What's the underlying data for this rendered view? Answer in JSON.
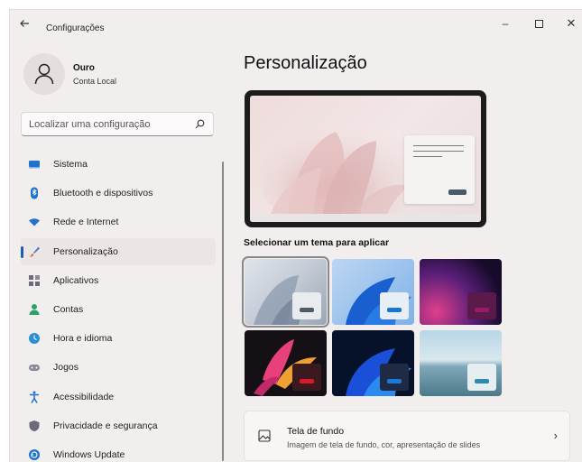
{
  "window": {
    "title": "Configurações",
    "back_icon": "arrow-left-icon",
    "controls": {
      "minimize": "–",
      "close": "✕"
    }
  },
  "profile": {
    "name": "Ouro",
    "account_type": "Conta Local",
    "avatar_icon": "person-icon"
  },
  "search": {
    "placeholder": "Localizar uma configuração",
    "icon": "search-icon"
  },
  "sidebar": {
    "items": [
      {
        "label": "Sistema",
        "icon": "monitor-icon",
        "color": "#1f73c9"
      },
      {
        "label": "Bluetooth e dispositivos",
        "icon": "bluetooth-icon",
        "color": "#1f73c9"
      },
      {
        "label": "Rede e Internet",
        "icon": "wifi-icon",
        "color": "#1f73c9"
      },
      {
        "label": "Personalização",
        "icon": "brush-icon",
        "color": "#d97a2b",
        "active": true
      },
      {
        "label": "Aplicativos",
        "icon": "apps-icon",
        "color": "#6b6b7b"
      },
      {
        "label": "Contas",
        "icon": "account-icon",
        "color": "#2aa36b"
      },
      {
        "label": "Hora e idioma",
        "icon": "globe-clock-icon",
        "color": "#2b8fd6"
      },
      {
        "label": "Jogos",
        "icon": "gamepad-icon",
        "color": "#7a7a86"
      },
      {
        "label": "Acessibilidade",
        "icon": "accessibility-icon",
        "color": "#1f6fd1"
      },
      {
        "label": "Privacidade e segurança",
        "icon": "shield-icon",
        "color": "#6b6b7b"
      },
      {
        "label": "Windows Update",
        "icon": "update-icon",
        "color": "#1f73c9"
      }
    ]
  },
  "main": {
    "title": "Personalização",
    "themes_label": "Selecionar um tema para aplicar",
    "themes": [
      {
        "name": "theme-light-gray",
        "selected": true,
        "accent": "#4f5c66"
      },
      {
        "name": "theme-blue-light",
        "selected": false,
        "accent": "#1a74d2"
      },
      {
        "name": "theme-purple-glow",
        "selected": false,
        "accent": "#9a1a6a"
      },
      {
        "name": "theme-flower-dark",
        "selected": false,
        "accent": "#d81a2a"
      },
      {
        "name": "theme-blue-dark",
        "selected": false,
        "accent": "#1a7ad8"
      },
      {
        "name": "theme-lake",
        "selected": false,
        "accent": "#2a8ab0"
      }
    ],
    "wallpaper": {
      "title": "Tela de fundo",
      "description": "Imagem de tela de fundo, cor, apresentação de slides",
      "icon": "image-icon"
    }
  }
}
